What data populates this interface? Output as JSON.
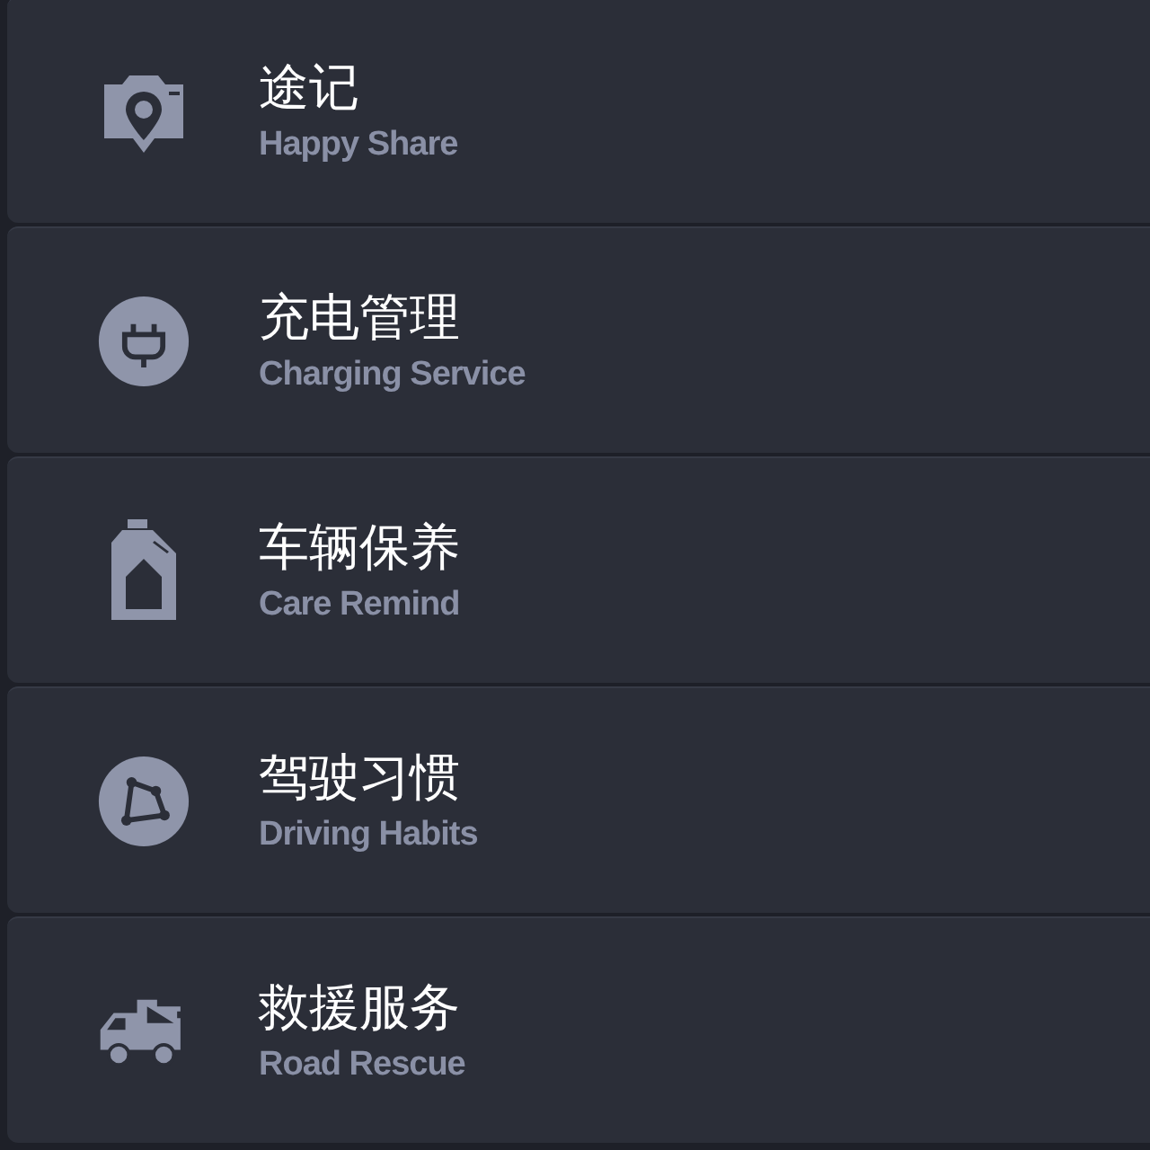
{
  "menu": [
    {
      "kind": "camera-pin",
      "title": "途记",
      "subtitle": "Happy Share"
    },
    {
      "kind": "plug",
      "title": "充电管理",
      "subtitle": "Charging Service"
    },
    {
      "kind": "bottle",
      "title": "车辆保养",
      "subtitle": "Care Remind"
    },
    {
      "kind": "graph",
      "title": "驾驶习惯",
      "subtitle": "Driving Habits"
    },
    {
      "kind": "truck",
      "title": "救援服务",
      "subtitle": "Road Rescue"
    }
  ]
}
